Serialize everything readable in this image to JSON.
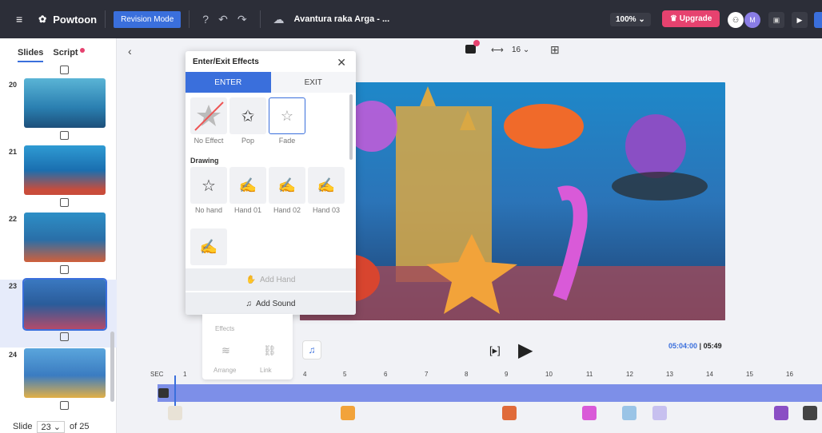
{
  "topbar": {
    "logo": "Powtoon",
    "mode": "Revision Mode",
    "project_title": "Avantura raka Arga - ...",
    "zoom": "100%",
    "upgrade_label": "Upgrade",
    "avatar_initial": "M"
  },
  "left": {
    "tab_slides": "Slides",
    "tab_script": "Script",
    "slides": [
      {
        "num": "20"
      },
      {
        "num": "21"
      },
      {
        "num": "22"
      },
      {
        "num": "23"
      },
      {
        "num": "24"
      }
    ],
    "footer_label": "Slide",
    "current": "23",
    "of": "of 25"
  },
  "canvas_toolbar": {
    "size": "16"
  },
  "panel": {
    "title": "Enter/Exit Effects",
    "tab_enter": "ENTER",
    "tab_exit": "EXIT",
    "effects": [
      {
        "label": "No Effect"
      },
      {
        "label": "Pop"
      },
      {
        "label": "Fade"
      }
    ],
    "section_drawing": "Drawing",
    "drawing": [
      {
        "label": "No hand"
      },
      {
        "label": "Hand 01"
      },
      {
        "label": "Hand 02"
      },
      {
        "label": "Hand 03"
      }
    ],
    "add_hand": "Add Hand",
    "add_sound": "Add Sound"
  },
  "under_menu": {
    "effects": "Effects",
    "arrange": "Arrange",
    "link": "Link"
  },
  "player": {
    "current": "05:04:00",
    "total": "05:49"
  },
  "timeline": {
    "sec": "SEC",
    "ticks": [
      "1",
      "4",
      "5",
      "6",
      "7",
      "8",
      "9",
      "10",
      "11",
      "12",
      "13",
      "14",
      "15",
      "16"
    ]
  }
}
